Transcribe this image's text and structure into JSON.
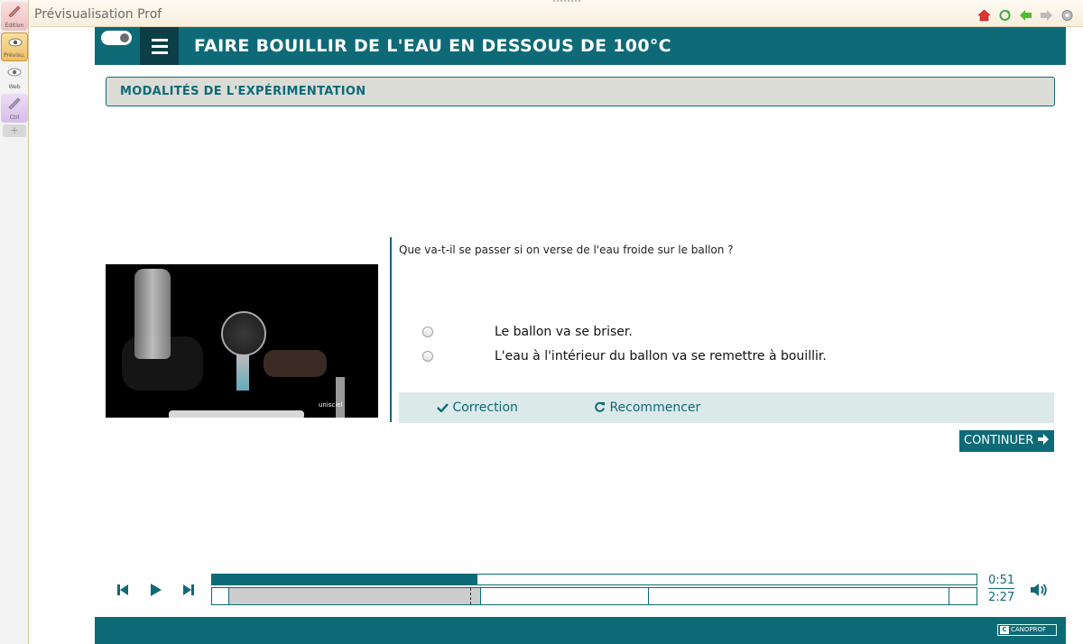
{
  "window": {
    "title": "Prévisualisation Prof"
  },
  "dock": {
    "items": [
      {
        "label": "Édition",
        "icon": "edit-icon"
      },
      {
        "label": "Prévisu.",
        "icon": "preview-eye-icon"
      },
      {
        "label": "Web",
        "icon": "web-eye-icon"
      },
      {
        "label": "Ctrl",
        "icon": "control-icon"
      }
    ],
    "add": "+"
  },
  "toolbar_icons": [
    "home-icon",
    "refresh-icon",
    "back-arrow-icon",
    "forward-arrow-icon",
    "settings-icon"
  ],
  "app": {
    "title": "FAIRE BOUILLIR DE L'EAU EN DESSOUS DE 100°C",
    "section_title": "MODALITÉS DE L'EXPÉRIMENTATION",
    "video_logo": "unisciel",
    "question": "Que va-t-il se passer si on verse de l'eau froide sur le ballon ?",
    "options": [
      "Le ballon va se briser.",
      "L'eau à l'intérieur du ballon va se remettre à bouillir."
    ],
    "correction_label": "Correction",
    "restart_label": "Recommencer",
    "continue_label": "CONTINUER"
  },
  "player": {
    "current_time": "0:51",
    "total_time": "2:27",
    "progress_fraction": 0.347
  },
  "footer": {
    "badge": "CANOPROF"
  },
  "colors": {
    "accent": "#0e6a77",
    "dark": "#0b3e47",
    "section_bg": "#dcdcd6",
    "actions_bg": "#dce9e9"
  }
}
